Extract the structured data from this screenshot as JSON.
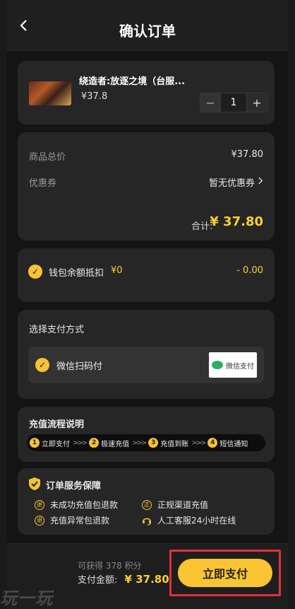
{
  "header": {
    "title": "确认订单"
  },
  "product": {
    "name": "绕造者:放逐之境（台服...",
    "price": "¥37.8",
    "quantity": "1",
    "minus": "−",
    "plus": "+"
  },
  "pricing": {
    "subtotal_label": "商品总价",
    "subtotal_value": "¥37.80",
    "coupon_label": "优惠券",
    "coupon_value": "暂无优惠券",
    "total_label": "合计:",
    "total_value": "¥ 37.80"
  },
  "wallet": {
    "label": "钱包余额抵扣",
    "balance": "¥0",
    "deduction": "- 0.00"
  },
  "payment": {
    "heading": "选择支付方式",
    "method": "微信扫码付",
    "logo_text": "微信支付"
  },
  "flow": {
    "heading": "充值流程说明",
    "steps": [
      {
        "num": "1",
        "label": "立即支付"
      },
      {
        "num": "2",
        "label": "极速充值"
      },
      {
        "num": "3",
        "label": "充值到账"
      },
      {
        "num": "4",
        "label": "短信通知"
      }
    ],
    "separator": ">>>"
  },
  "guarantee": {
    "heading": "订单服务保障",
    "items": [
      {
        "icon": "退",
        "label": "未成功充值包退款"
      },
      {
        "icon": "正",
        "label": "正规渠道充值"
      },
      {
        "icon": "退",
        "label": "充值异常包退款"
      },
      {
        "icon": "headset-icon",
        "label": "人工客服24小时在线"
      }
    ]
  },
  "footer": {
    "points": "可获得 378 积分",
    "amount_label": "支付金额:",
    "amount_value": "¥ 37.80",
    "pay_button": "立即支付"
  },
  "watermark": {
    "text": "玩一玩"
  },
  "colors": {
    "accent": "#f9c532",
    "price": "#ffcf2e",
    "highlight_border": "#e0303f"
  }
}
